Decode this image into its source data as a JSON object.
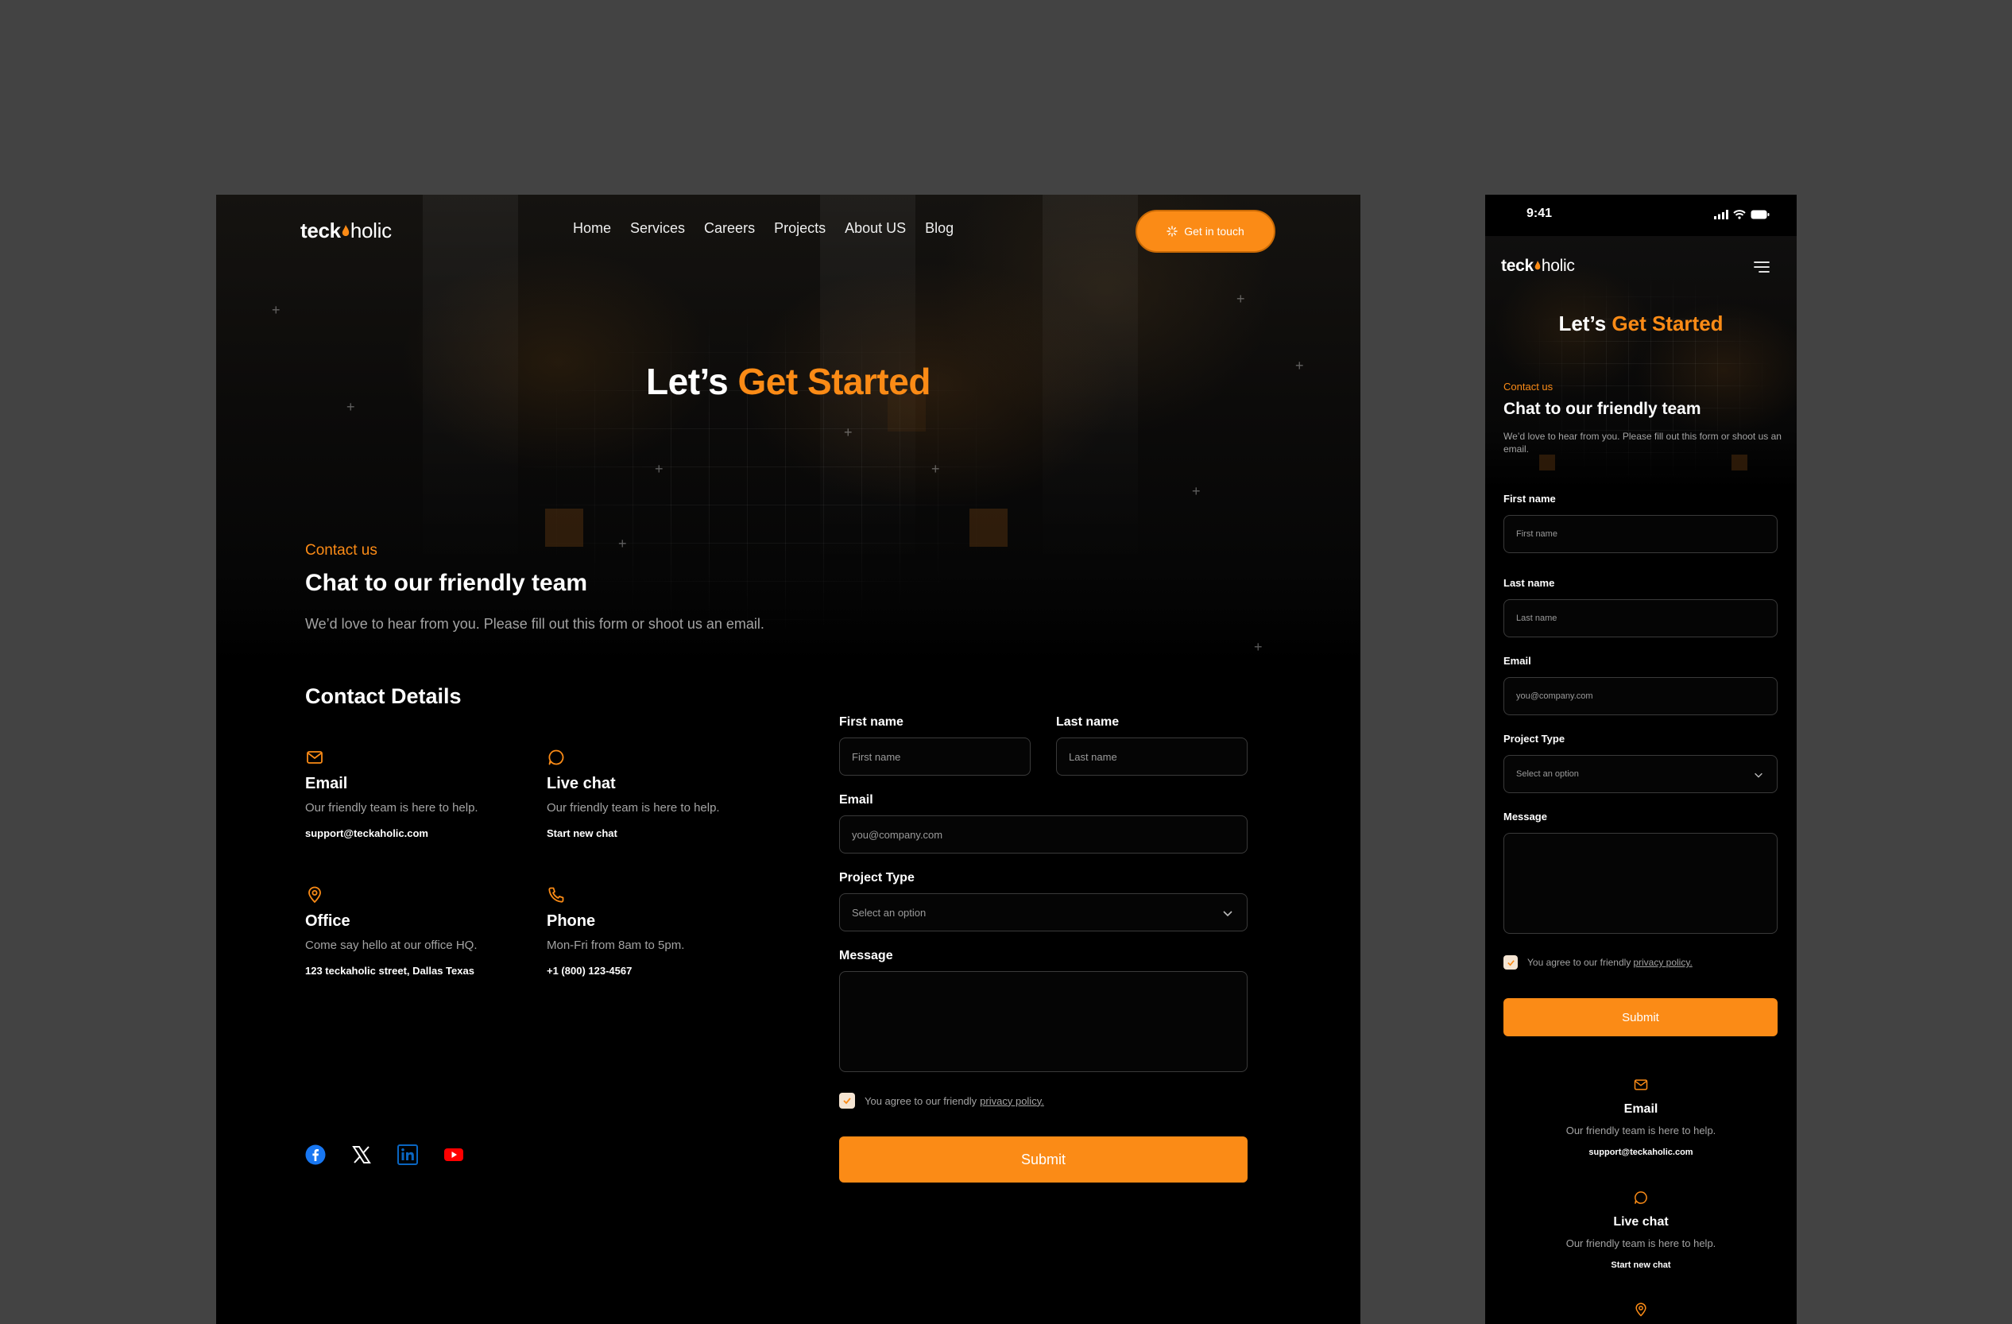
{
  "brand": {
    "logo_left": "teck",
    "logo_right": "holic",
    "accent": "#fb8b16"
  },
  "nav": {
    "links": [
      "Home",
      "Services",
      "Careers",
      "Projects",
      "About US",
      "Blog"
    ],
    "cta": "Get in touch"
  },
  "hero": {
    "title_plain": "Let’s",
    "title_accent": "Get Started"
  },
  "contact": {
    "eyebrow": "Contact us",
    "title": "Chat to our friendly team",
    "subtitle": "We’d love to hear from you. Please fill out this form or shoot us an email."
  },
  "details": {
    "title": "Contact Details",
    "items": [
      {
        "icon": "mail-icon",
        "title": "Email",
        "desc": "Our friendly team is here to help.",
        "value": "support@teckaholic.com"
      },
      {
        "icon": "chat-icon",
        "title": "Live chat",
        "desc": "Our friendly team is here to help.",
        "value": "Start new chat"
      },
      {
        "icon": "map-pin-icon",
        "title": "Office",
        "desc": "Come say hello at our office HQ.",
        "value": "123 teckaholic street, Dallas Texas"
      },
      {
        "icon": "phone-icon",
        "title": "Phone",
        "desc": "Mon-Fri from 8am to 5pm.",
        "value": "+1 (800) 123-4567"
      }
    ]
  },
  "socials": [
    "facebook-icon",
    "x-icon",
    "linkedin-icon",
    "youtube-icon"
  ],
  "form": {
    "first_name": {
      "label": "First name",
      "placeholder": "First name"
    },
    "last_name": {
      "label": "Last name",
      "placeholder": "Last name"
    },
    "email": {
      "label": "Email",
      "placeholder": "you@company.com"
    },
    "project_type": {
      "label": "Project Type",
      "placeholder": "Select an option"
    },
    "message": {
      "label": "Message"
    },
    "agree_text": "You agree to our friendly",
    "agree_link": "privacy policy.",
    "submit": "Submit"
  },
  "mobile": {
    "time": "9:41"
  }
}
